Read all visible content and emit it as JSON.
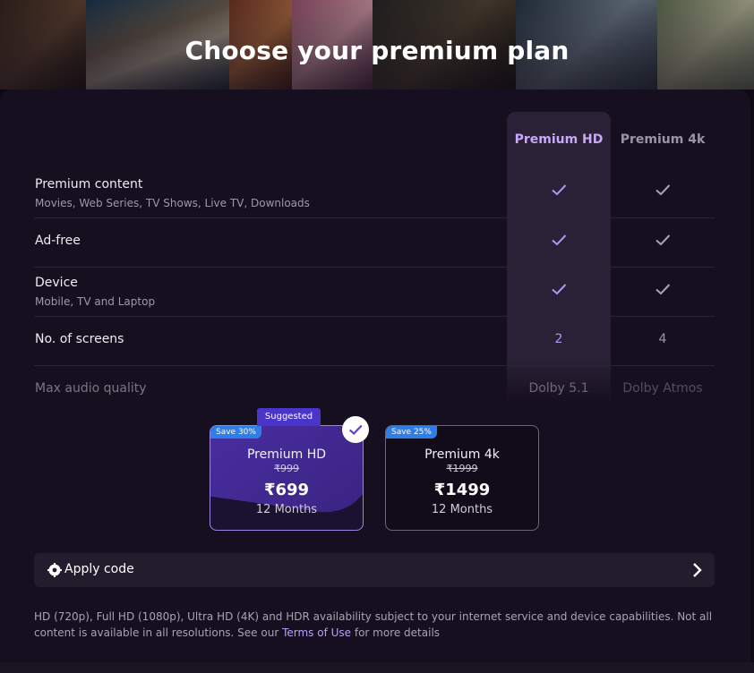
{
  "page": {
    "title": "Choose your premium plan"
  },
  "columns": {
    "hd": "Premium HD",
    "k4": "Premium 4k"
  },
  "features": [
    {
      "label": "Premium content",
      "sub": "Movies, Web Series, TV Shows, Live TV, Downloads",
      "hd": "check",
      "k4": "check"
    },
    {
      "label": "Ad-free",
      "sub": "",
      "hd": "check",
      "k4": "check"
    },
    {
      "label": "Device",
      "sub": "Mobile, TV and Laptop",
      "hd": "check",
      "k4": "check"
    },
    {
      "label": "No. of screens",
      "sub": "",
      "hd": "2",
      "k4": "4"
    },
    {
      "label": "Max audio quality",
      "sub": "",
      "hd": "Dolby 5.1",
      "k4": "Dolby Atmos"
    }
  ],
  "plans": [
    {
      "badge": "Save 30%",
      "name": "Premium HD",
      "old_price": "₹999",
      "price": "₹699",
      "duration": "12 Months",
      "selected": true
    },
    {
      "badge": "Save 25%",
      "name": "Premium 4k",
      "old_price": "₹1999",
      "price": "₹1499",
      "duration": "12 Months",
      "selected": false
    }
  ],
  "suggested_label": "Suggested",
  "apply_code": {
    "label": "Apply code",
    "icon": "gear-badge-icon"
  },
  "footnote": {
    "text_before": "HD (720p), Full HD (1080p), Ultra HD (4K) and HDR availability subject to your internet service and device capabilities. Not all content is available in all resolutions. See our ",
    "link": "Terms of Use",
    "text_after": " for more details"
  },
  "colors": {
    "accent": "#b592f2",
    "background": "#160f20",
    "badge": "#2f7ee8",
    "suggested": "#4b34c8"
  }
}
